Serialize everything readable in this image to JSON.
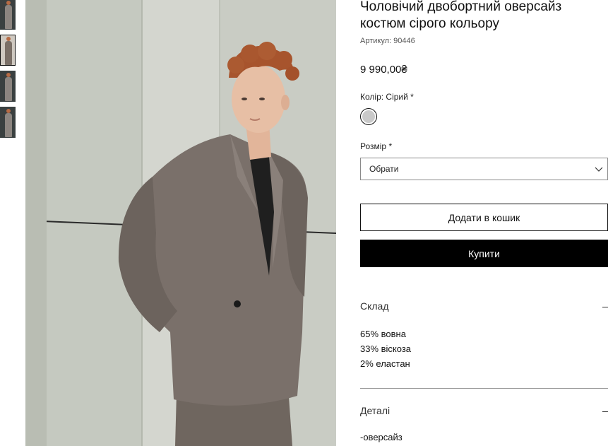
{
  "gallery": {
    "thumbnails": [
      {
        "name": "thumb-1",
        "active": false,
        "tone": "dark"
      },
      {
        "name": "thumb-2",
        "active": true,
        "tone": "light"
      },
      {
        "name": "thumb-3",
        "active": false,
        "tone": "dark"
      },
      {
        "name": "thumb-4",
        "active": false,
        "tone": "dark"
      }
    ],
    "main_photo": "man-in-grey-double-breasted-suit-photo"
  },
  "product": {
    "title": "Чоловічий двобортний оверсайз костюм сірого кольору",
    "sku_label": "Артикул: 90446",
    "price": "9 990,00₴"
  },
  "color": {
    "label": "Колір: Сірий *",
    "swatch_color": "#c9c9c9"
  },
  "size": {
    "label": "Розмір *",
    "selected": "Обрати"
  },
  "actions": {
    "add_to_cart": "Додати в кошик",
    "buy": "Купити"
  },
  "composition": {
    "heading": "Склад",
    "items": [
      "65% вовна",
      "33% віскоза",
      "2% еластан"
    ]
  },
  "details": {
    "heading": "Деталі",
    "first_line": "-оверсайз"
  },
  "colors": {
    "buy_button_bg": "#000000",
    "text": "#111111"
  }
}
